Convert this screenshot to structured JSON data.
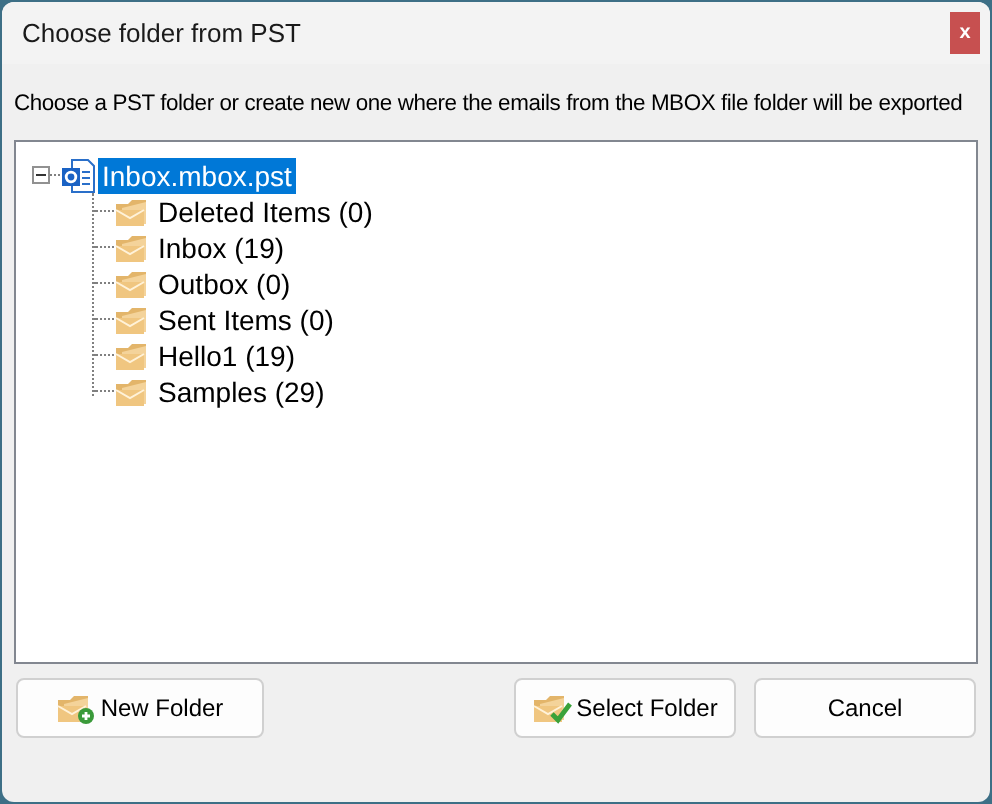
{
  "window": {
    "title": "Choose folder from PST",
    "close": "x"
  },
  "instruction": "Choose a PST folder or create new one where the emails from the MBOX file folder will be exported",
  "tree": {
    "label": "Inbox.mbox.pst",
    "selected": true,
    "expanded": true,
    "children": [
      {
        "label": "Deleted Items (0)",
        "selected": false
      },
      {
        "label": "Inbox (19)",
        "selected": false
      },
      {
        "label": "Outbox (0)",
        "selected": false
      },
      {
        "label": "Sent Items (0)",
        "selected": false
      },
      {
        "label": "Hello1 (19)",
        "selected": false
      },
      {
        "label": "Samples (29)",
        "selected": false
      }
    ]
  },
  "buttons": [
    {
      "kind": "new",
      "label": "New Folder"
    },
    {
      "kind": "select",
      "label": "Select Folder"
    },
    {
      "kind": "cancel",
      "label": "Cancel"
    }
  ]
}
